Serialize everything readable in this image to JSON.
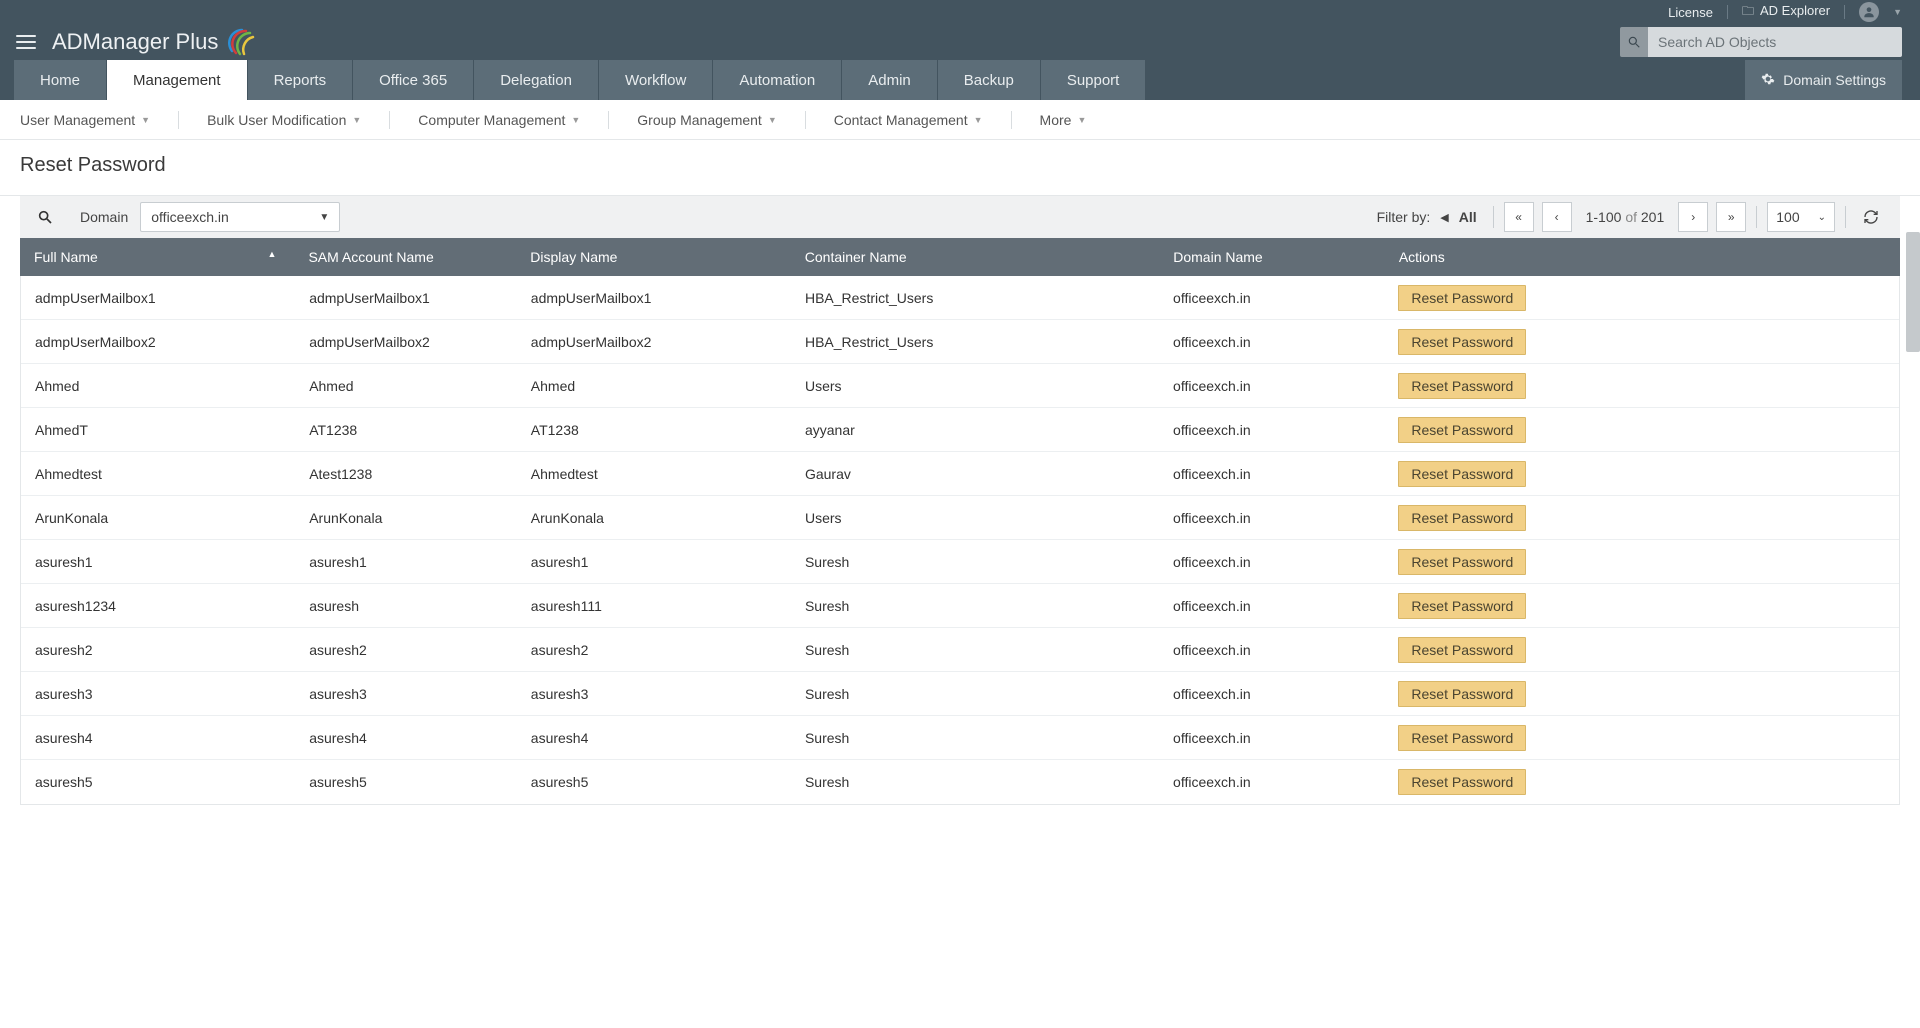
{
  "header": {
    "license": "License",
    "ad_explorer": "AD Explorer",
    "search_placeholder": "Search AD Objects",
    "brand": "ADManager",
    "brand_suffix": "Plus"
  },
  "nav_tabs": [
    "Home",
    "Management",
    "Reports",
    "Office 365",
    "Delegation",
    "Workflow",
    "Automation",
    "Admin",
    "Backup",
    "Support"
  ],
  "nav_active_index": 1,
  "domain_settings_label": "Domain Settings",
  "subnav": [
    "User Management",
    "Bulk User Modification",
    "Computer Management",
    "Group Management",
    "Contact Management",
    "More"
  ],
  "page_title": "Reset Password",
  "toolbar": {
    "domain_label": "Domain",
    "domain_value": "officeexch.in",
    "filter_by_label": "Filter by:",
    "filter_value": "All",
    "range": "1-100",
    "of": "of",
    "total": "201",
    "page_size": "100"
  },
  "columns": {
    "full_name": "Full Name",
    "sam": "SAM Account Name",
    "display": "Display Name",
    "container": "Container Name",
    "domain": "Domain Name",
    "actions": "Actions"
  },
  "action_label": "Reset Password",
  "rows": [
    {
      "full": "admpUserMailbox1",
      "sam": "admpUserMailbox1",
      "disp": "admpUserMailbox1",
      "cont": "HBA_Restrict_Users",
      "dom": "officeexch.in"
    },
    {
      "full": "admpUserMailbox2",
      "sam": "admpUserMailbox2",
      "disp": "admpUserMailbox2",
      "cont": "HBA_Restrict_Users",
      "dom": "officeexch.in"
    },
    {
      "full": "Ahmed",
      "sam": "Ahmed",
      "disp": "Ahmed",
      "cont": "Users",
      "dom": "officeexch.in"
    },
    {
      "full": "AhmedT",
      "sam": "AT1238",
      "disp": "AT1238",
      "cont": "ayyanar",
      "dom": "officeexch.in"
    },
    {
      "full": "Ahmedtest",
      "sam": "Atest1238",
      "disp": "Ahmedtest",
      "cont": "Gaurav",
      "dom": "officeexch.in"
    },
    {
      "full": "ArunKonala",
      "sam": "ArunKonala",
      "disp": "ArunKonala",
      "cont": "Users",
      "dom": "officeexch.in"
    },
    {
      "full": "asuresh1",
      "sam": "asuresh1",
      "disp": "asuresh1",
      "cont": "Suresh",
      "dom": "officeexch.in"
    },
    {
      "full": "asuresh1234",
      "sam": "asuresh",
      "disp": "asuresh111",
      "cont": "Suresh",
      "dom": "officeexch.in"
    },
    {
      "full": "asuresh2",
      "sam": "asuresh2",
      "disp": "asuresh2",
      "cont": "Suresh",
      "dom": "officeexch.in"
    },
    {
      "full": "asuresh3",
      "sam": "asuresh3",
      "disp": "asuresh3",
      "cont": "Suresh",
      "dom": "officeexch.in"
    },
    {
      "full": "asuresh4",
      "sam": "asuresh4",
      "disp": "asuresh4",
      "cont": "Suresh",
      "dom": "officeexch.in"
    },
    {
      "full": "asuresh5",
      "sam": "asuresh5",
      "disp": "asuresh5",
      "cont": "Suresh",
      "dom": "officeexch.in"
    }
  ]
}
